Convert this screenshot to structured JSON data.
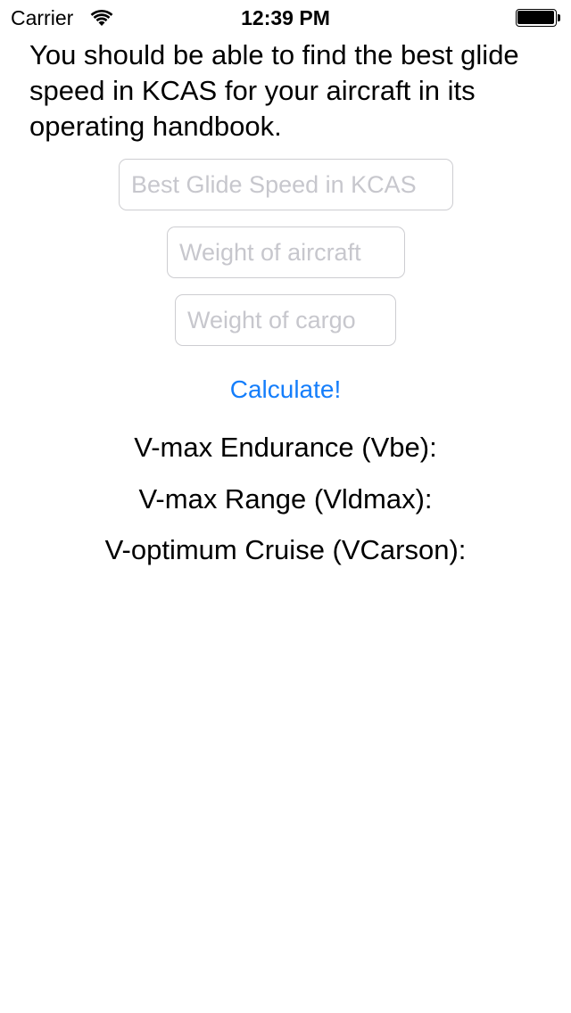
{
  "status_bar": {
    "carrier": "Carrier",
    "time": "12:39 PM",
    "wifi_icon": "wifi-icon",
    "battery_icon": "battery-icon",
    "battery_level": 1.0
  },
  "instructions": "You should be able to find the best glide speed in KCAS for your aircraft in its operating handbook.",
  "fields": {
    "glide_speed_placeholder": "Best Glide Speed in KCAS",
    "aircraft_weight_placeholder": "Weight of aircraft",
    "cargo_weight_placeholder": "Weight of cargo",
    "glide_speed_value": "",
    "aircraft_weight_value": "",
    "cargo_weight_value": ""
  },
  "calculate_label": "Calculate!",
  "results": {
    "vbe_label": "V-max Endurance (Vbe):",
    "vldmax_label": "V-max Range (Vldmax):",
    "vcarson_label": "V-optimum Cruise (VCarson):"
  },
  "colors": {
    "accent": "#157efb",
    "placeholder": "#c7c7cd",
    "field_border": "#cdcdd1",
    "text": "#000000",
    "background": "#ffffff"
  }
}
